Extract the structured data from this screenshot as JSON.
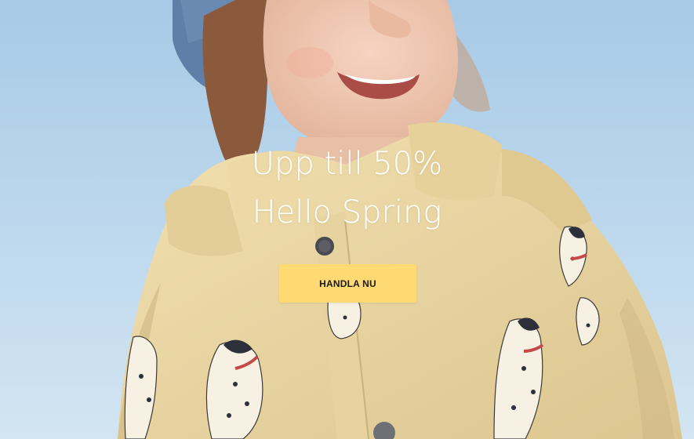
{
  "hero": {
    "headline_line1": "Upp till 50%",
    "headline_line2": "Hello Spring",
    "cta_label": "HANDLA NU"
  },
  "colors": {
    "cta_background": "#ffda73",
    "headline_text": "#ffffff",
    "sky": "#b7d3ea",
    "jacket": "#ead8a6"
  }
}
